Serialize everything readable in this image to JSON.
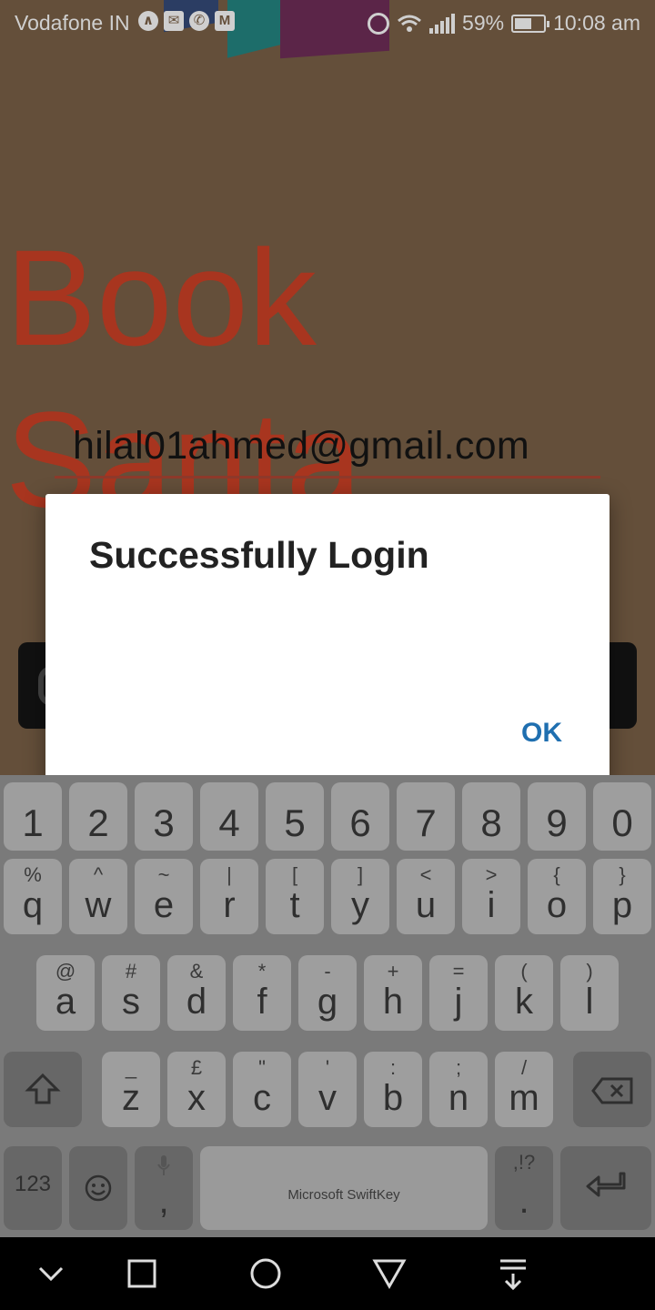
{
  "status_bar": {
    "carrier": "Vodafone IN",
    "battery": "59%",
    "time": "10:08 am",
    "notification_icons": [
      "navigation-icon",
      "mail-icon",
      "whatsapp-icon",
      "gmail-icon"
    ],
    "system_icons": [
      "alarm-icon",
      "wifi-icon",
      "signal-icon",
      "battery-icon"
    ],
    "battery_level": 0.59
  },
  "app": {
    "title_line1": "Book",
    "title_line2": "Santa",
    "email_value": "hilal01ahmed@gmail.com",
    "accent_color": "#b8331a"
  },
  "dialog": {
    "title": "Successfully Login",
    "ok_label": "OK"
  },
  "keyboard": {
    "brand": "Microsoft SwiftKey",
    "number_row": [
      "1",
      "2",
      "3",
      "4",
      "5",
      "6",
      "7",
      "8",
      "9",
      "0"
    ],
    "row1": [
      [
        "q",
        "%"
      ],
      [
        "w",
        "^"
      ],
      [
        "e",
        "~"
      ],
      [
        "r",
        "|"
      ],
      [
        "t",
        "["
      ],
      [
        "y",
        "]"
      ],
      [
        "u",
        "<"
      ],
      [
        "i",
        ">"
      ],
      [
        "o",
        "{"
      ],
      [
        "p",
        "}"
      ]
    ],
    "row2": [
      [
        "a",
        "@"
      ],
      [
        "s",
        "#"
      ],
      [
        "d",
        "&"
      ],
      [
        "f",
        "*"
      ],
      [
        "g",
        "-"
      ],
      [
        "h",
        "+"
      ],
      [
        "j",
        "="
      ],
      [
        "k",
        "("
      ],
      [
        "l",
        ")"
      ]
    ],
    "row3": [
      [
        "z",
        "_"
      ],
      [
        "x",
        "£"
      ],
      [
        "c",
        "\""
      ],
      [
        "v",
        "'"
      ],
      [
        "b",
        ":"
      ],
      [
        "n",
        ";"
      ],
      [
        "m",
        "/"
      ]
    ],
    "symbols_key": "123",
    "comma_key": ",",
    "period_key": ".",
    "period_alt": ",!?"
  },
  "nav_bar": {
    "icons": [
      "hide-keyboard-icon",
      "recents-icon",
      "home-icon",
      "back-icon",
      "notification-pulldown-icon"
    ]
  }
}
